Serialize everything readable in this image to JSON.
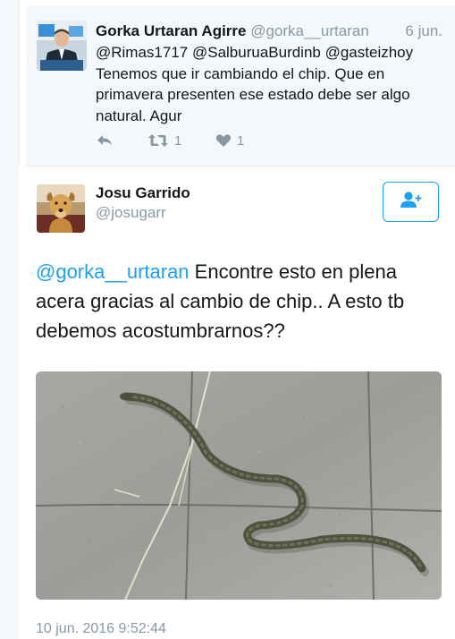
{
  "reply_tweet": {
    "author_name": "Gorka Urtaran Agirre",
    "author_handle": "@gorka__urtaran",
    "date": "6 jun.",
    "text_lines": [
      "@Rimas1717 @SalburuaBurdinb @gasteizhoy",
      "Tenemos que ir cambiando el chip. Que en",
      "primavera presenten ese estado debe ser algo",
      "natural.  Agur"
    ],
    "retweet_count": "1",
    "like_count": "1",
    "icons": {
      "reply": "reply-icon",
      "retweet": "retweet-icon",
      "like": "heart-icon"
    }
  },
  "main_tweet": {
    "author_name": "Josu Garrido",
    "author_handle": "@josugarr",
    "mention": "@gorka__urtaran",
    "text_rest": " Encontre esto en plena acera gracias al cambio de chip.. A esto tb debemos acostumbrarnos??",
    "timestamp": "10 jun. 2016 9:52:44",
    "follow_icon": "add-user-icon"
  },
  "colors": {
    "accent": "#1da1f2",
    "muted": "#8899a6",
    "text": "#14171a",
    "reply_background": "#f5f8fa"
  }
}
